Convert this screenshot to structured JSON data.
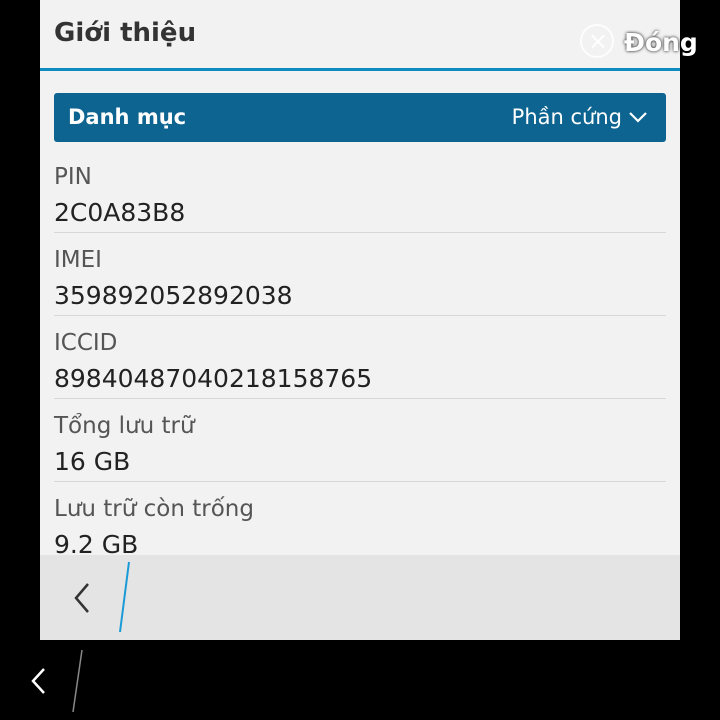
{
  "header": {
    "title": "Giới thiệu"
  },
  "close": {
    "label": "Đóng"
  },
  "category": {
    "label": "Danh mục",
    "value": "Phần cứng"
  },
  "rows": [
    {
      "label": "PIN",
      "value": "2C0A83B8"
    },
    {
      "label": "IMEI",
      "value": "359892052892038"
    },
    {
      "label": "ICCID",
      "value": "89840487040218158765"
    },
    {
      "label": "Tổng lưu trữ",
      "value": "16 GB"
    },
    {
      "label": "Lưu trữ còn trống",
      "value": "9.2 GB"
    }
  ],
  "colors": {
    "accent": "#0e8cbf",
    "category_bg": "#0d6490"
  }
}
